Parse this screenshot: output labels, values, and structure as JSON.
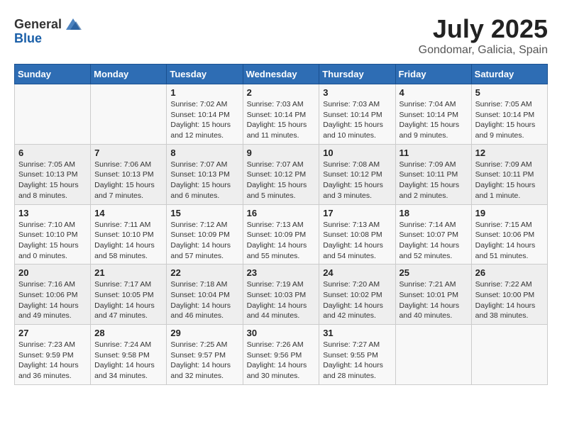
{
  "logo": {
    "general": "General",
    "blue": "Blue"
  },
  "title": "July 2025",
  "subtitle": "Gondomar, Galicia, Spain",
  "weekdays": [
    "Sunday",
    "Monday",
    "Tuesday",
    "Wednesday",
    "Thursday",
    "Friday",
    "Saturday"
  ],
  "weeks": [
    [
      null,
      null,
      {
        "day": 1,
        "sunrise": "7:02 AM",
        "sunset": "10:14 PM",
        "daylight": "15 hours and 12 minutes."
      },
      {
        "day": 2,
        "sunrise": "7:03 AM",
        "sunset": "10:14 PM",
        "daylight": "15 hours and 11 minutes."
      },
      {
        "day": 3,
        "sunrise": "7:03 AM",
        "sunset": "10:14 PM",
        "daylight": "15 hours and 10 minutes."
      },
      {
        "day": 4,
        "sunrise": "7:04 AM",
        "sunset": "10:14 PM",
        "daylight": "15 hours and 9 minutes."
      },
      {
        "day": 5,
        "sunrise": "7:05 AM",
        "sunset": "10:14 PM",
        "daylight": "15 hours and 9 minutes."
      }
    ],
    [
      {
        "day": 6,
        "sunrise": "7:05 AM",
        "sunset": "10:13 PM",
        "daylight": "15 hours and 8 minutes."
      },
      {
        "day": 7,
        "sunrise": "7:06 AM",
        "sunset": "10:13 PM",
        "daylight": "15 hours and 7 minutes."
      },
      {
        "day": 8,
        "sunrise": "7:07 AM",
        "sunset": "10:13 PM",
        "daylight": "15 hours and 6 minutes."
      },
      {
        "day": 9,
        "sunrise": "7:07 AM",
        "sunset": "10:12 PM",
        "daylight": "15 hours and 5 minutes."
      },
      {
        "day": 10,
        "sunrise": "7:08 AM",
        "sunset": "10:12 PM",
        "daylight": "15 hours and 3 minutes."
      },
      {
        "day": 11,
        "sunrise": "7:09 AM",
        "sunset": "10:11 PM",
        "daylight": "15 hours and 2 minutes."
      },
      {
        "day": 12,
        "sunrise": "7:09 AM",
        "sunset": "10:11 PM",
        "daylight": "15 hours and 1 minute."
      }
    ],
    [
      {
        "day": 13,
        "sunrise": "7:10 AM",
        "sunset": "10:10 PM",
        "daylight": "15 hours and 0 minutes."
      },
      {
        "day": 14,
        "sunrise": "7:11 AM",
        "sunset": "10:10 PM",
        "daylight": "14 hours and 58 minutes."
      },
      {
        "day": 15,
        "sunrise": "7:12 AM",
        "sunset": "10:09 PM",
        "daylight": "14 hours and 57 minutes."
      },
      {
        "day": 16,
        "sunrise": "7:13 AM",
        "sunset": "10:09 PM",
        "daylight": "14 hours and 55 minutes."
      },
      {
        "day": 17,
        "sunrise": "7:13 AM",
        "sunset": "10:08 PM",
        "daylight": "14 hours and 54 minutes."
      },
      {
        "day": 18,
        "sunrise": "7:14 AM",
        "sunset": "10:07 PM",
        "daylight": "14 hours and 52 minutes."
      },
      {
        "day": 19,
        "sunrise": "7:15 AM",
        "sunset": "10:06 PM",
        "daylight": "14 hours and 51 minutes."
      }
    ],
    [
      {
        "day": 20,
        "sunrise": "7:16 AM",
        "sunset": "10:06 PM",
        "daylight": "14 hours and 49 minutes."
      },
      {
        "day": 21,
        "sunrise": "7:17 AM",
        "sunset": "10:05 PM",
        "daylight": "14 hours and 47 minutes."
      },
      {
        "day": 22,
        "sunrise": "7:18 AM",
        "sunset": "10:04 PM",
        "daylight": "14 hours and 46 minutes."
      },
      {
        "day": 23,
        "sunrise": "7:19 AM",
        "sunset": "10:03 PM",
        "daylight": "14 hours and 44 minutes."
      },
      {
        "day": 24,
        "sunrise": "7:20 AM",
        "sunset": "10:02 PM",
        "daylight": "14 hours and 42 minutes."
      },
      {
        "day": 25,
        "sunrise": "7:21 AM",
        "sunset": "10:01 PM",
        "daylight": "14 hours and 40 minutes."
      },
      {
        "day": 26,
        "sunrise": "7:22 AM",
        "sunset": "10:00 PM",
        "daylight": "14 hours and 38 minutes."
      }
    ],
    [
      {
        "day": 27,
        "sunrise": "7:23 AM",
        "sunset": "9:59 PM",
        "daylight": "14 hours and 36 minutes."
      },
      {
        "day": 28,
        "sunrise": "7:24 AM",
        "sunset": "9:58 PM",
        "daylight": "14 hours and 34 minutes."
      },
      {
        "day": 29,
        "sunrise": "7:25 AM",
        "sunset": "9:57 PM",
        "daylight": "14 hours and 32 minutes."
      },
      {
        "day": 30,
        "sunrise": "7:26 AM",
        "sunset": "9:56 PM",
        "daylight": "14 hours and 30 minutes."
      },
      {
        "day": 31,
        "sunrise": "7:27 AM",
        "sunset": "9:55 PM",
        "daylight": "14 hours and 28 minutes."
      },
      null,
      null
    ]
  ],
  "labels": {
    "sunrise": "Sunrise:",
    "sunset": "Sunset:",
    "daylight": "Daylight:"
  }
}
